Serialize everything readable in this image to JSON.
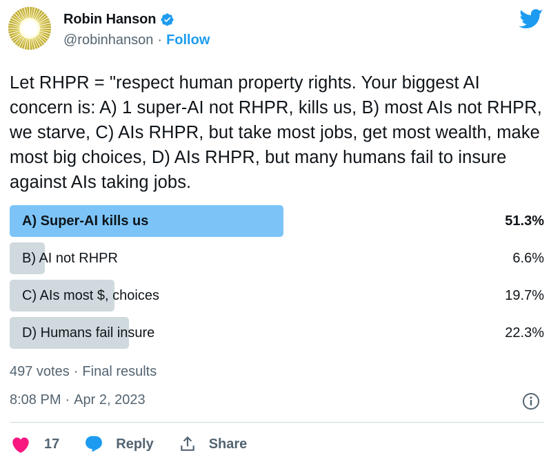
{
  "author": {
    "name": "Robin Hanson",
    "handle": "@robinhanson",
    "separator": "·",
    "follow_label": "Follow"
  },
  "icons": {
    "avatar": "sunburst-avatar-icon",
    "verified": "verified-badge-icon",
    "brand": "twitter-bird-icon",
    "info": "info-icon",
    "like": "heart-icon",
    "reply": "reply-bubble-icon",
    "share": "share-upload-icon"
  },
  "colors": {
    "accent": "#1d9bf0",
    "winner_bar": "#7cc4f8",
    "bar": "#cfd9de",
    "like": "#f91880",
    "muted": "#536471"
  },
  "tweet": {
    "text": "Let RHPR = \"respect human property rights. Your biggest AI concern is: A) 1 super-AI not RHPR, kills us, B) most AIs not RHPR, we starve, C) AIs RHPR, but take most jobs, get most wealth, make most big choices, D) AIs RHPR, but many humans fail to insure against AIs taking jobs."
  },
  "poll": {
    "options": [
      {
        "label": "A) Super-AI kills us",
        "percent_label": "51.3%",
        "percent": 51.3,
        "winner": true
      },
      {
        "label": "B) AI not RHPR",
        "percent_label": "6.6%",
        "percent": 6.6,
        "winner": false
      },
      {
        "label": "C) AIs most $, choices",
        "percent_label": "19.7%",
        "percent": 19.7,
        "winner": false
      },
      {
        "label": "D) Humans fail insure",
        "percent_label": "22.3%",
        "percent": 22.3,
        "winner": false
      }
    ],
    "votes": "497 votes",
    "separator": "·",
    "status": "Final results"
  },
  "meta": {
    "time": "8:08 PM",
    "separator": "·",
    "date": "Apr 2, 2023"
  },
  "actions": {
    "like_count": "17",
    "reply_label": "Reply",
    "share_label": "Share"
  }
}
